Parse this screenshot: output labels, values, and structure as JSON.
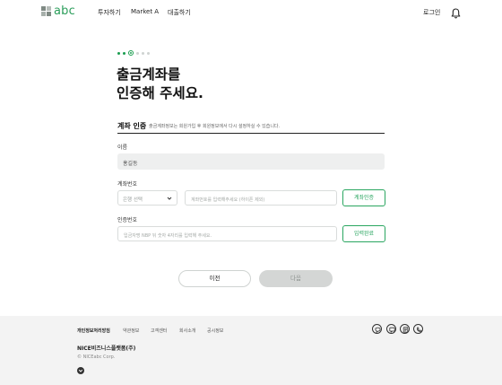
{
  "header": {
    "logo_text": "abc",
    "nav": [
      {
        "label": "투자하기"
      },
      {
        "label": "Market A"
      },
      {
        "label": "대출하기"
      }
    ],
    "login_label": "로그인"
  },
  "title": {
    "line1": "출금계좌를",
    "line2": "인증해 주세요."
  },
  "section": {
    "title": "계좌 인증",
    "description": "출금계좌정보는 회원가입 후 회원정보에서 다시 설정하실 수 있습니다."
  },
  "form": {
    "name_label": "이름",
    "name_value": "홍길동",
    "account_label": "계좌번호",
    "bank_select_value": "은행 선택",
    "account_placeholder": "계좌번호를 입력해주세요 (하이픈 제외)",
    "account_verify_button": "계좌인증",
    "code_label": "인증번호",
    "code_placeholder": "입금자명 NBP 뒤 숫자 4자리를 입력해 주세요.",
    "code_confirm_button": "입력완료"
  },
  "buttons": {
    "prev": "이전",
    "next": "다음"
  },
  "stepper": {
    "current_step": 3,
    "total_steps": 6
  },
  "footer": {
    "links": [
      {
        "label": "개인정보처리방침"
      },
      {
        "label": "약관정보"
      },
      {
        "label": "고객센터"
      },
      {
        "label": "회사소개"
      },
      {
        "label": "공시정보"
      }
    ],
    "company": "NICE비즈니스플랫폼(주)",
    "copyright": "© NICEabc Corp."
  },
  "colors": {
    "brand_green": "#2aa660",
    "disabled_button": "#d4d6d5",
    "footer_bg": "#f3f3f3"
  }
}
